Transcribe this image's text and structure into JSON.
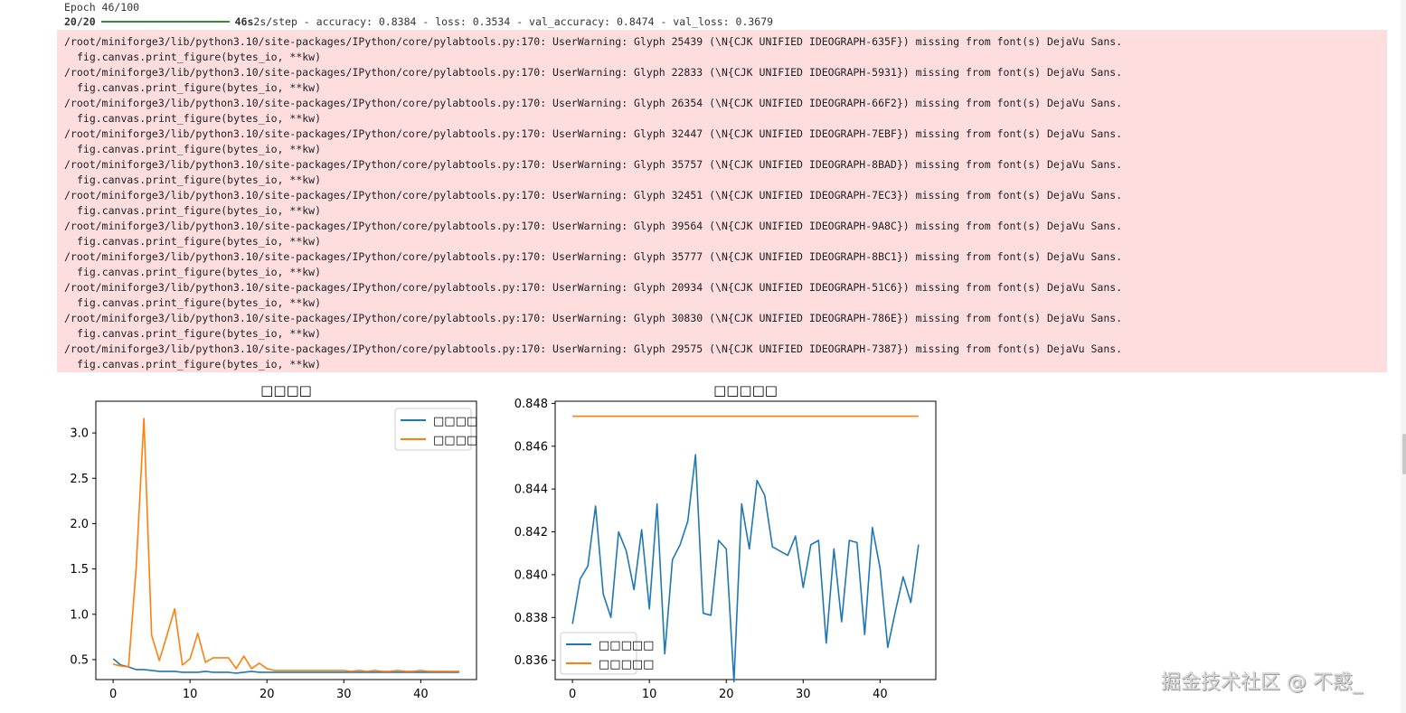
{
  "output": {
    "epoch": "Epoch 46/100",
    "progress": {
      "steps": "20/20",
      "time": "46s",
      "rest": "2s/step - accuracy: 0.8384 - loss: 0.3534 - val_accuracy: 0.8474 - val_loss: 0.3679",
      "fraction": 1.0
    },
    "warnings": [
      {
        "path": "/root/miniforge3/lib/python3.10/site-packages/IPython/core/pylabtools.py:170: UserWarning: Glyph 25439 (\\N{CJK UNIFIED IDEOGRAPH-635F}) missing from font(s) DejaVu Sans.",
        "code": "fig.canvas.print_figure(bytes_io, **kw)"
      },
      {
        "path": "/root/miniforge3/lib/python3.10/site-packages/IPython/core/pylabtools.py:170: UserWarning: Glyph 22833 (\\N{CJK UNIFIED IDEOGRAPH-5931}) missing from font(s) DejaVu Sans.",
        "code": "fig.canvas.print_figure(bytes_io, **kw)"
      },
      {
        "path": "/root/miniforge3/lib/python3.10/site-packages/IPython/core/pylabtools.py:170: UserWarning: Glyph 26354 (\\N{CJK UNIFIED IDEOGRAPH-66F2}) missing from font(s) DejaVu Sans.",
        "code": "fig.canvas.print_figure(bytes_io, **kw)"
      },
      {
        "path": "/root/miniforge3/lib/python3.10/site-packages/IPython/core/pylabtools.py:170: UserWarning: Glyph 32447 (\\N{CJK UNIFIED IDEOGRAPH-7EBF}) missing from font(s) DejaVu Sans.",
        "code": "fig.canvas.print_figure(bytes_io, **kw)"
      },
      {
        "path": "/root/miniforge3/lib/python3.10/site-packages/IPython/core/pylabtools.py:170: UserWarning: Glyph 35757 (\\N{CJK UNIFIED IDEOGRAPH-8BAD}) missing from font(s) DejaVu Sans.",
        "code": "fig.canvas.print_figure(bytes_io, **kw)"
      },
      {
        "path": "/root/miniforge3/lib/python3.10/site-packages/IPython/core/pylabtools.py:170: UserWarning: Glyph 32451 (\\N{CJK UNIFIED IDEOGRAPH-7EC3}) missing from font(s) DejaVu Sans.",
        "code": "fig.canvas.print_figure(bytes_io, **kw)"
      },
      {
        "path": "/root/miniforge3/lib/python3.10/site-packages/IPython/core/pylabtools.py:170: UserWarning: Glyph 39564 (\\N{CJK UNIFIED IDEOGRAPH-9A8C}) missing from font(s) DejaVu Sans.",
        "code": "fig.canvas.print_figure(bytes_io, **kw)"
      },
      {
        "path": "/root/miniforge3/lib/python3.10/site-packages/IPython/core/pylabtools.py:170: UserWarning: Glyph 35777 (\\N{CJK UNIFIED IDEOGRAPH-8BC1}) missing from font(s) DejaVu Sans.",
        "code": "fig.canvas.print_figure(bytes_io, **kw)"
      },
      {
        "path": "/root/miniforge3/lib/python3.10/site-packages/IPython/core/pylabtools.py:170: UserWarning: Glyph 20934 (\\N{CJK UNIFIED IDEOGRAPH-51C6}) missing from font(s) DejaVu Sans.",
        "code": "fig.canvas.print_figure(bytes_io, **kw)"
      },
      {
        "path": "/root/miniforge3/lib/python3.10/site-packages/IPython/core/pylabtools.py:170: UserWarning: Glyph 30830 (\\N{CJK UNIFIED IDEOGRAPH-786E}) missing from font(s) DejaVu Sans.",
        "code": "fig.canvas.print_figure(bytes_io, **kw)"
      },
      {
        "path": "/root/miniforge3/lib/python3.10/site-packages/IPython/core/pylabtools.py:170: UserWarning: Glyph 29575 (\\N{CJK UNIFIED IDEOGRAPH-7387}) missing from font(s) DejaVu Sans.",
        "code": "fig.canvas.print_figure(bytes_io, **kw)"
      }
    ]
  },
  "watermark": "掘金技术社区 @ 不惑_",
  "colors": {
    "series_blue": "#1f77b4",
    "series_orange": "#ff7f0e",
    "stderr_bg": "#fddddd",
    "progress_bar": "#3a8a3a"
  },
  "chart_data": [
    {
      "type": "line",
      "title": "□□□□",
      "xlim": [
        -2.25,
        47.25
      ],
      "ylim": [
        0.28,
        3.35
      ],
      "xticks": [
        0,
        10,
        20,
        30,
        40
      ],
      "yticks": [
        0.5,
        1.0,
        1.5,
        2.0,
        2.5,
        3.0
      ],
      "legend_position": "upper right",
      "grid": false,
      "series": [
        {
          "name": "□□□□",
          "color": "#1f77b4",
          "x": [
            0,
            1,
            2,
            3,
            4,
            5,
            6,
            7,
            8,
            9,
            10,
            11,
            12,
            13,
            14,
            15,
            16,
            17,
            18,
            19,
            20,
            21,
            22,
            23,
            24,
            25,
            26,
            27,
            28,
            29,
            30,
            31,
            32,
            33,
            34,
            35,
            36,
            37,
            38,
            39,
            40,
            41,
            42,
            43,
            44,
            45
          ],
          "values": [
            0.51,
            0.44,
            0.42,
            0.39,
            0.39,
            0.38,
            0.37,
            0.37,
            0.37,
            0.36,
            0.36,
            0.36,
            0.37,
            0.36,
            0.36,
            0.36,
            0.35,
            0.36,
            0.37,
            0.36,
            0.36,
            0.36,
            0.36,
            0.36,
            0.36,
            0.36,
            0.36,
            0.36,
            0.36,
            0.36,
            0.36,
            0.36,
            0.36,
            0.36,
            0.36,
            0.36,
            0.36,
            0.36,
            0.36,
            0.36,
            0.36,
            0.36,
            0.36,
            0.36,
            0.36,
            0.36
          ]
        },
        {
          "name": "□□□□",
          "color": "#ff7f0e",
          "x": [
            0,
            1,
            2,
            3,
            4,
            5,
            6,
            7,
            8,
            9,
            10,
            11,
            12,
            13,
            14,
            15,
            16,
            17,
            18,
            19,
            20,
            21,
            22,
            23,
            24,
            25,
            26,
            27,
            28,
            29,
            30,
            31,
            32,
            33,
            34,
            35,
            36,
            37,
            38,
            39,
            40,
            41,
            42,
            43,
            44,
            45
          ],
          "values": [
            0.45,
            0.43,
            0.42,
            1.52,
            3.16,
            0.77,
            0.49,
            0.77,
            1.06,
            0.44,
            0.51,
            0.79,
            0.47,
            0.52,
            0.52,
            0.52,
            0.4,
            0.54,
            0.4,
            0.46,
            0.4,
            0.38,
            0.38,
            0.38,
            0.38,
            0.38,
            0.38,
            0.38,
            0.38,
            0.38,
            0.38,
            0.37,
            0.38,
            0.37,
            0.38,
            0.37,
            0.37,
            0.38,
            0.37,
            0.37,
            0.38,
            0.37,
            0.37,
            0.37,
            0.37,
            0.37
          ]
        }
      ]
    },
    {
      "type": "line",
      "title": "□□□□□",
      "xlim": [
        -2.25,
        47.25
      ],
      "ylim": [
        0.8351,
        0.8481
      ],
      "xticks": [
        0,
        10,
        20,
        30,
        40
      ],
      "yticks": [
        "0.836",
        "0.838",
        "0.840",
        "0.842",
        "0.844",
        "0.846",
        "0.848"
      ],
      "legend_position": "lower left",
      "grid": false,
      "series": [
        {
          "name": "□□□□□",
          "color": "#1f77b4",
          "x": [
            0,
            1,
            2,
            3,
            4,
            5,
            6,
            7,
            8,
            9,
            10,
            11,
            12,
            13,
            14,
            15,
            16,
            17,
            18,
            19,
            20,
            21,
            22,
            23,
            24,
            25,
            26,
            27,
            28,
            29,
            30,
            31,
            32,
            33,
            34,
            35,
            36,
            37,
            38,
            39,
            40,
            41,
            42,
            43,
            44,
            45
          ],
          "values": [
            0.8377,
            0.8398,
            0.8404,
            0.8432,
            0.8391,
            0.838,
            0.842,
            0.8411,
            0.8393,
            0.8421,
            0.8384,
            0.8433,
            0.8363,
            0.8407,
            0.8414,
            0.8425,
            0.8456,
            0.8382,
            0.8381,
            0.8416,
            0.8412,
            0.835,
            0.8433,
            0.8412,
            0.8444,
            0.8437,
            0.8413,
            0.8411,
            0.8409,
            0.8418,
            0.8394,
            0.8414,
            0.8416,
            0.8368,
            0.8412,
            0.8378,
            0.8416,
            0.8415,
            0.8372,
            0.8422,
            0.8403,
            0.8366,
            0.8383,
            0.8399,
            0.8387,
            0.8414
          ]
        },
        {
          "name": "□□□□□",
          "color": "#ff7f0e",
          "x": [
            0,
            45
          ],
          "values": [
            0.8474,
            0.8474
          ]
        }
      ]
    }
  ]
}
